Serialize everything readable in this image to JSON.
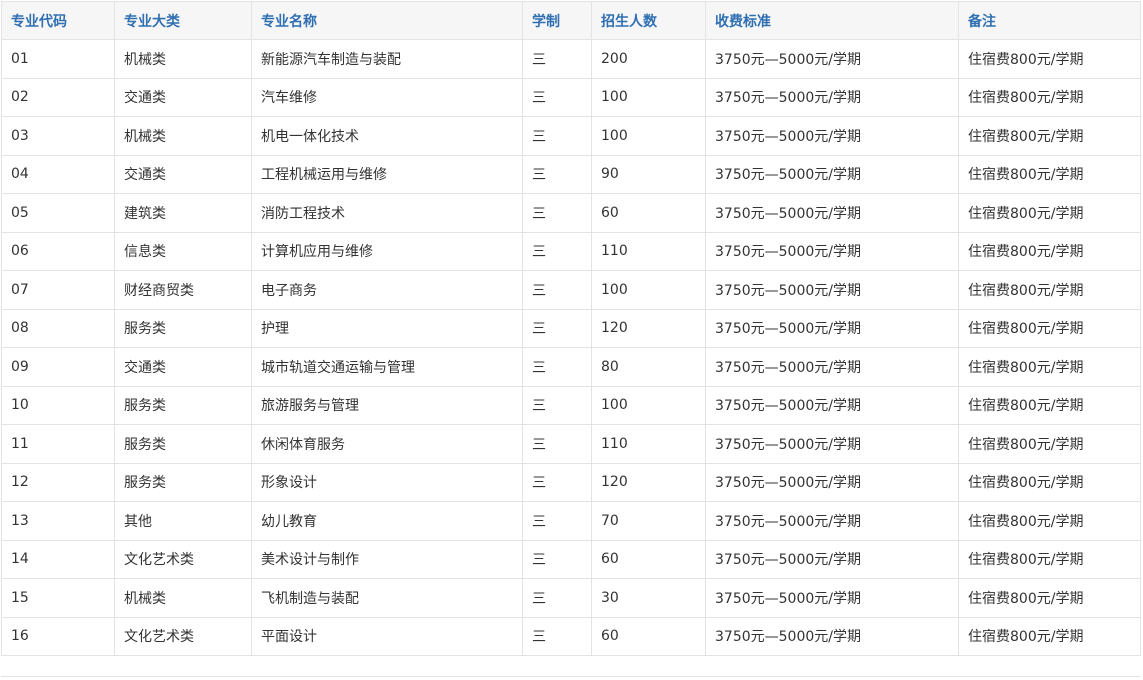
{
  "table": {
    "headers": [
      "专业代码",
      "专业大类",
      "专业名称",
      "学制",
      "招生人数",
      "收费标准",
      "备注"
    ],
    "rows": [
      [
        "01",
        "机械类",
        "新能源汽车制造与装配",
        "三",
        "200",
        "3750元—5000元/学期",
        "住宿费800元/学期"
      ],
      [
        "02",
        "交通类",
        "汽车维修",
        "三",
        "100",
        "3750元—5000元/学期",
        "住宿费800元/学期"
      ],
      [
        "03",
        "机械类",
        "机电一体化技术",
        "三",
        "100",
        "3750元—5000元/学期",
        "住宿费800元/学期"
      ],
      [
        "04",
        "交通类",
        "工程机械运用与维修",
        "三",
        "90",
        "3750元—5000元/学期",
        "住宿费800元/学期"
      ],
      [
        "05",
        "建筑类",
        "消防工程技术",
        "三",
        "60",
        "3750元—5000元/学期",
        "住宿费800元/学期"
      ],
      [
        "06",
        "信息类",
        "计算机应用与维修",
        "三",
        "110",
        "3750元—5000元/学期",
        "住宿费800元/学期"
      ],
      [
        "07",
        "财经商贸类",
        "电子商务",
        "三",
        "100",
        "3750元—5000元/学期",
        "住宿费800元/学期"
      ],
      [
        "08",
        "服务类",
        "护理",
        "三",
        "120",
        "3750元—5000元/学期",
        "住宿费800元/学期"
      ],
      [
        "09",
        "交通类",
        "城市轨道交通运输与管理",
        "三",
        "80",
        "3750元—5000元/学期",
        "住宿费800元/学期"
      ],
      [
        "10",
        "服务类",
        "旅游服务与管理",
        "三",
        "100",
        "3750元—5000元/学期",
        "住宿费800元/学期"
      ],
      [
        "11",
        "服务类",
        "休闲体育服务",
        "三",
        "110",
        "3750元—5000元/学期",
        "住宿费800元/学期"
      ],
      [
        "12",
        "服务类",
        "形象设计",
        "三",
        "120",
        "3750元—5000元/学期",
        "住宿费800元/学期"
      ],
      [
        "13",
        "其他",
        "幼儿教育",
        "三",
        "70",
        "3750元—5000元/学期",
        "住宿费800元/学期"
      ],
      [
        "14",
        "文化艺术类",
        "美术设计与制作",
        "三",
        "60",
        "3750元—5000元/学期",
        "住宿费800元/学期"
      ],
      [
        "15",
        "机械类",
        "飞机制造与装配",
        "三",
        "30",
        "3750元—5000元/学期",
        "住宿费800元/学期"
      ],
      [
        "16",
        "文化艺术类",
        "平面设计",
        "三",
        "60",
        "3750元—5000元/学期",
        "住宿费800元/学期"
      ]
    ]
  },
  "colors": {
    "header_text": "#2f6fb2",
    "header_bg": "#f6f6f6",
    "border": "#e3e3e3",
    "body_text": "#333333"
  }
}
